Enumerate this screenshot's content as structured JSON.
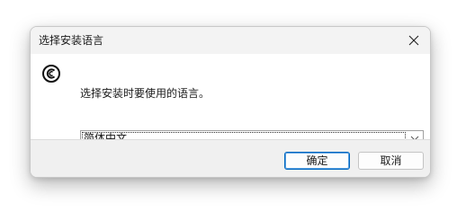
{
  "window": {
    "title": "选择安装语言",
    "close_icon": "close-icon"
  },
  "body": {
    "app_icon": "setup-app-icon",
    "prompt": "选择安装时要使用的语言。"
  },
  "language_select": {
    "selected": "简体中文",
    "arrow_icon": "chevron-down-icon"
  },
  "footer": {
    "ok_label": "确定",
    "cancel_label": "取消"
  },
  "colors": {
    "accent": "#0067c0",
    "titlebar_bg": "#f3f3f3",
    "footer_bg": "#f0f0f0"
  }
}
